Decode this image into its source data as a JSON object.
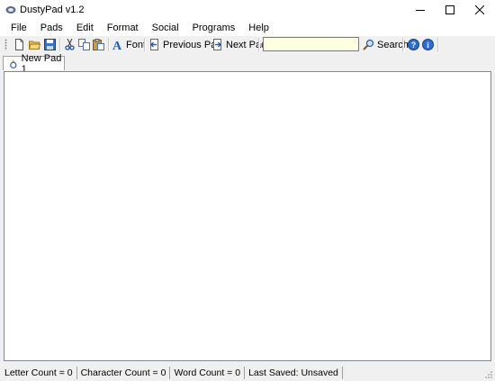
{
  "window": {
    "title": "DustyPad v1.2"
  },
  "menu": {
    "items": [
      {
        "label": "File"
      },
      {
        "label": "Pads"
      },
      {
        "label": "Edit"
      },
      {
        "label": "Format"
      },
      {
        "label": "Social"
      },
      {
        "label": "Programs"
      },
      {
        "label": "Help"
      }
    ]
  },
  "toolbar": {
    "font_label": "Font",
    "previous_pad_label": "Previous Pad",
    "next_pad_label": "Next Pad",
    "search_value": "",
    "search_label": "Search",
    "icons": [
      "new-document-icon",
      "open-folder-icon",
      "save-icon",
      "cut-icon",
      "copy-icon",
      "paste-icon",
      "font-icon",
      "previous-pad-icon",
      "next-pad-icon",
      "search-icon",
      "help-icon",
      "info-icon"
    ]
  },
  "tabs": [
    {
      "label": "New Pad 1",
      "icon": "pad-icon"
    }
  ],
  "editor": {
    "content": ""
  },
  "status": {
    "letter_count": "Letter Count = 0",
    "character_count": "Character Count = 0",
    "word_count": "Word Count = 0",
    "last_saved": "Last Saved: Unsaved"
  },
  "colors": {
    "search_bg": "#ffffe1",
    "accent_blue": "#1e5bb8",
    "window_bg": "#f0f0f0"
  }
}
